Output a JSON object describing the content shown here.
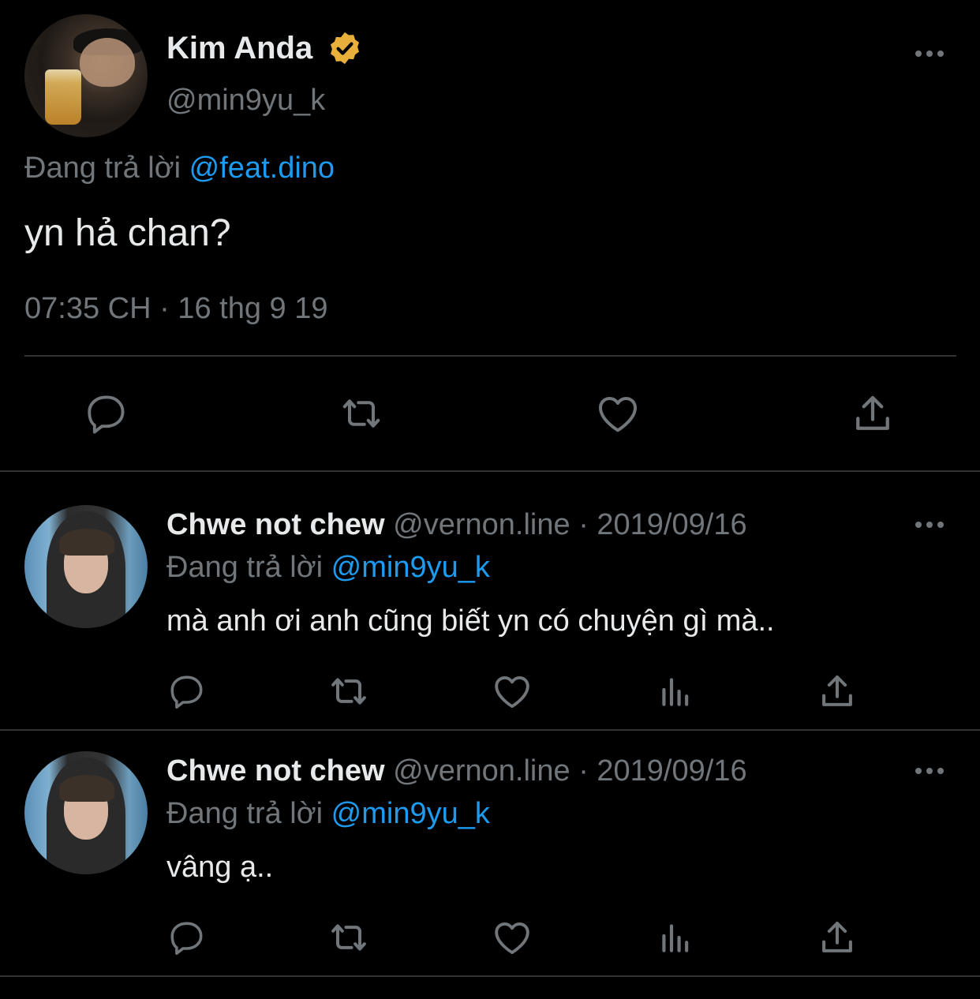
{
  "main_tweet": {
    "display_name": "Kim Anda",
    "handle": "@min9yu_k",
    "replying_label": "Đang trả lời",
    "replying_to": "@feat.dino",
    "text": "yn hả chan?",
    "timestamp": "07:35 CH · 16 thg 9 19",
    "verified_color": "#e8b03a"
  },
  "replies": [
    {
      "display_name": "Chwe not chew",
      "handle": "@vernon.line",
      "date": "· 2019/09/16",
      "replying_label": "Đang trả lời",
      "replying_to": "@min9yu_k",
      "text": "mà anh ơi anh cũng biết yn có chuyện gì mà.."
    },
    {
      "display_name": "Chwe not chew",
      "handle": "@vernon.line",
      "date": "· 2019/09/16",
      "replying_label": "Đang trả lời",
      "replying_to": "@min9yu_k",
      "text": "vâng ạ.."
    }
  ],
  "icons": {
    "reply": "reply-icon",
    "retweet": "retweet-icon",
    "like": "like-icon",
    "analytics": "analytics-icon",
    "share": "share-icon",
    "more": "more-icon"
  },
  "colors": {
    "background": "#000000",
    "text": "#e7e9ea",
    "muted": "#71767b",
    "link": "#1d9bf0",
    "divider": "#2f3336"
  }
}
